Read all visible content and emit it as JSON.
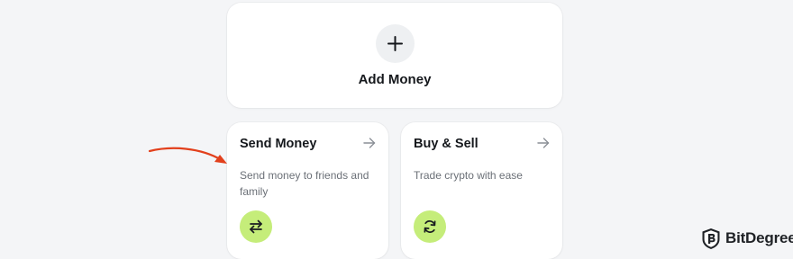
{
  "add_money": {
    "label": "Add Money",
    "icon": "plus-icon"
  },
  "cards": [
    {
      "title": "Send Money",
      "description": "Send money to friends and family",
      "arrow_icon": "arrow-right-icon",
      "badge_icon": "transfer-arrows-icon"
    },
    {
      "title": "Buy & Sell",
      "description": "Trade crypto with ease",
      "arrow_icon": "arrow-right-icon",
      "badge_icon": "refresh-icon"
    }
  ],
  "annotation": {
    "icon": "red-pointer-arrow",
    "color": "#e2401c"
  },
  "watermark": {
    "brand": "BitDegree",
    "icon": "bitdegree-shield-logo"
  },
  "colors": {
    "background": "#f4f5f7",
    "card": "#ffffff",
    "accent_badge": "#c5ed7a",
    "icon_circle": "#eef0f2"
  }
}
